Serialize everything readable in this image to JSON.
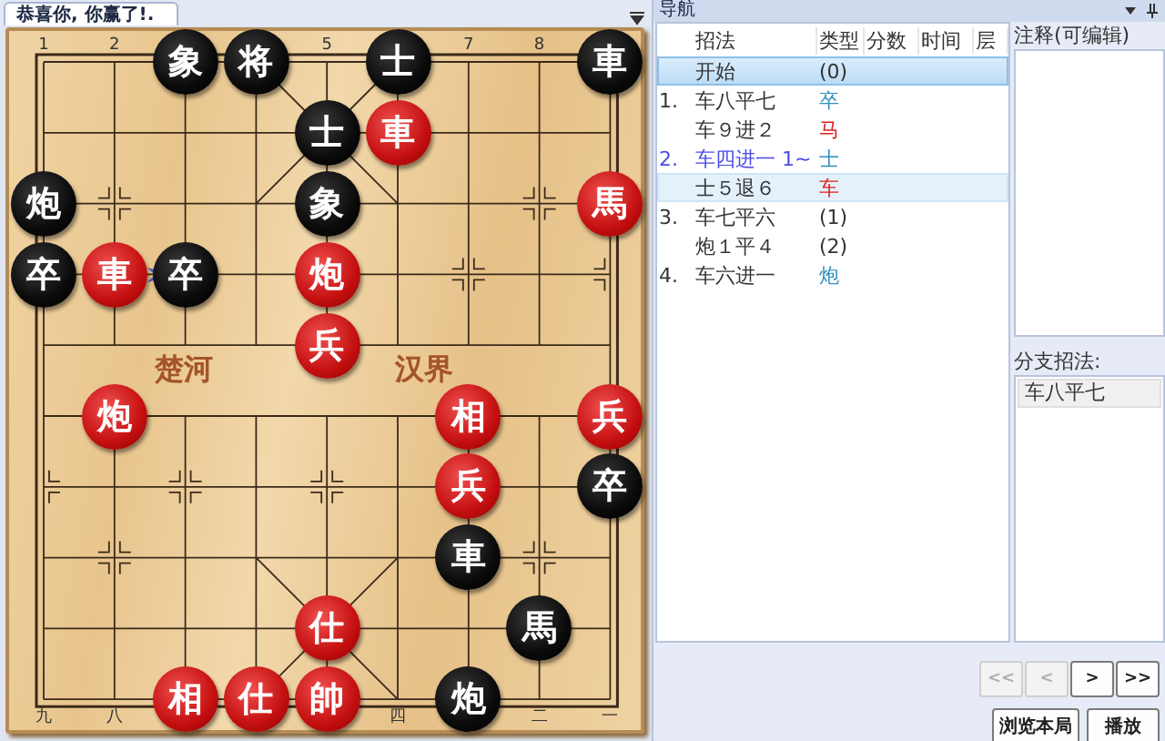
{
  "tab": {
    "title": "恭喜你, 你赢了!."
  },
  "board": {
    "river": [
      "楚河",
      "汉界"
    ],
    "rows": [
      {
        "cells": [
          {
            "file_label": "1"
          },
          {
            "file_label": "2"
          },
          {
            "piece": "象",
            "red": false
          },
          {
            "piece": "将",
            "red": false
          },
          {
            "file_label": "5"
          },
          {
            "piece": "士",
            "red": false
          },
          {
            "file_label": "7"
          },
          {
            "file_label": "8"
          },
          {
            "piece": "車",
            "red": false
          }
        ]
      },
      {
        "cells": [
          {},
          {},
          {},
          {},
          {
            "piece": "士",
            "red": false
          },
          {
            "piece": "車",
            "red": true
          },
          {},
          {},
          {}
        ]
      },
      {
        "cells": [
          {
            "piece": "炮",
            "red": false
          },
          {},
          {},
          {},
          {
            "piece": "象",
            "red": false
          },
          {},
          {},
          {},
          {
            "piece": "馬",
            "red": true
          }
        ]
      },
      {
        "cells": [
          {
            "piece": "卒",
            "red": false
          },
          {
            "piece": "車",
            "red": true
          },
          {
            "piece": "卒",
            "red": false
          },
          {},
          {
            "piece": "炮",
            "red": true
          },
          {},
          {},
          {},
          {}
        ]
      },
      {
        "cells": [
          {},
          {},
          {},
          {},
          {
            "piece": "兵",
            "red": true
          },
          {},
          {},
          {},
          {}
        ]
      },
      {
        "cells": [
          {},
          {
            "piece": "炮",
            "red": true
          },
          {},
          {},
          {},
          {},
          {
            "piece": "相",
            "red": true
          },
          {},
          {
            "piece": "兵",
            "red": true
          }
        ]
      },
      {
        "cells": [
          {},
          {},
          {},
          {},
          {},
          {},
          {
            "piece": "兵",
            "red": true
          },
          {},
          {
            "piece": "卒",
            "red": false
          }
        ]
      },
      {
        "cells": [
          {},
          {},
          {},
          {},
          {},
          {},
          {
            "piece": "車",
            "red": false
          },
          {},
          {}
        ]
      },
      {
        "cells": [
          {},
          {},
          {},
          {},
          {
            "piece": "仕",
            "red": true
          },
          {},
          {},
          {
            "piece": "馬",
            "red": false
          },
          {}
        ]
      },
      {
        "cells": [
          {
            "file_label": "九"
          },
          {
            "file_label": "八"
          },
          {
            "piece": "相",
            "red": true
          },
          {
            "piece": "仕",
            "red": true
          },
          {
            "piece": "帥",
            "red": true
          },
          {
            "file_label": "四"
          },
          {
            "piece": "炮",
            "red": false
          },
          {
            "file_label": "二"
          },
          {
            "file_label": "一"
          }
        ]
      }
    ]
  },
  "navigator": {
    "title": "导航",
    "columns": [
      "招法",
      "类型",
      "分数",
      "时间",
      "层"
    ],
    "moves": [
      {
        "move": "开始",
        "type": "(0)",
        "color": "#333333",
        "selected": true,
        "highlighted": false,
        "branch": false
      },
      {
        "number": "1.",
        "move": "车八平七",
        "type": "卒",
        "color": "#2f8fc0",
        "selected": false,
        "highlighted": false,
        "branch": false
      },
      {
        "move": "车９进２",
        "type": "马",
        "color": "#e02020",
        "selected": false,
        "highlighted": false,
        "branch": false
      },
      {
        "number": "2.",
        "move": "车四进一 1~",
        "type": "士",
        "color": "#2f8fc0",
        "selected": false,
        "highlighted": false,
        "branch": true
      },
      {
        "move": "士５退６",
        "type": "车",
        "color": "#e02020",
        "selected": false,
        "highlighted": true,
        "branch": false
      },
      {
        "number": "3.",
        "move": "车七平六",
        "type": "(1)",
        "color": "#333333",
        "selected": false,
        "highlighted": false,
        "branch": false
      },
      {
        "move": "炮１平４",
        "type": "(2)",
        "color": "#333333",
        "selected": false,
        "highlighted": false,
        "branch": false
      },
      {
        "number": "4.",
        "move": "车六进一",
        "type": "炮",
        "color": "#2f8fc0",
        "selected": false,
        "highlighted": false,
        "branch": false
      }
    ],
    "notes": {
      "label": "注释(可编辑)"
    },
    "branches": {
      "label": "分支招法:",
      "items": [
        "车八平七"
      ]
    },
    "step_buttons": [
      {
        "label": "<<",
        "disabled": true
      },
      {
        "label": "<",
        "disabled": true
      },
      {
        "label": ">",
        "disabled": false
      },
      {
        "label": ">>",
        "disabled": false
      }
    ],
    "actions": [
      "浏览本局",
      "播放"
    ]
  }
}
